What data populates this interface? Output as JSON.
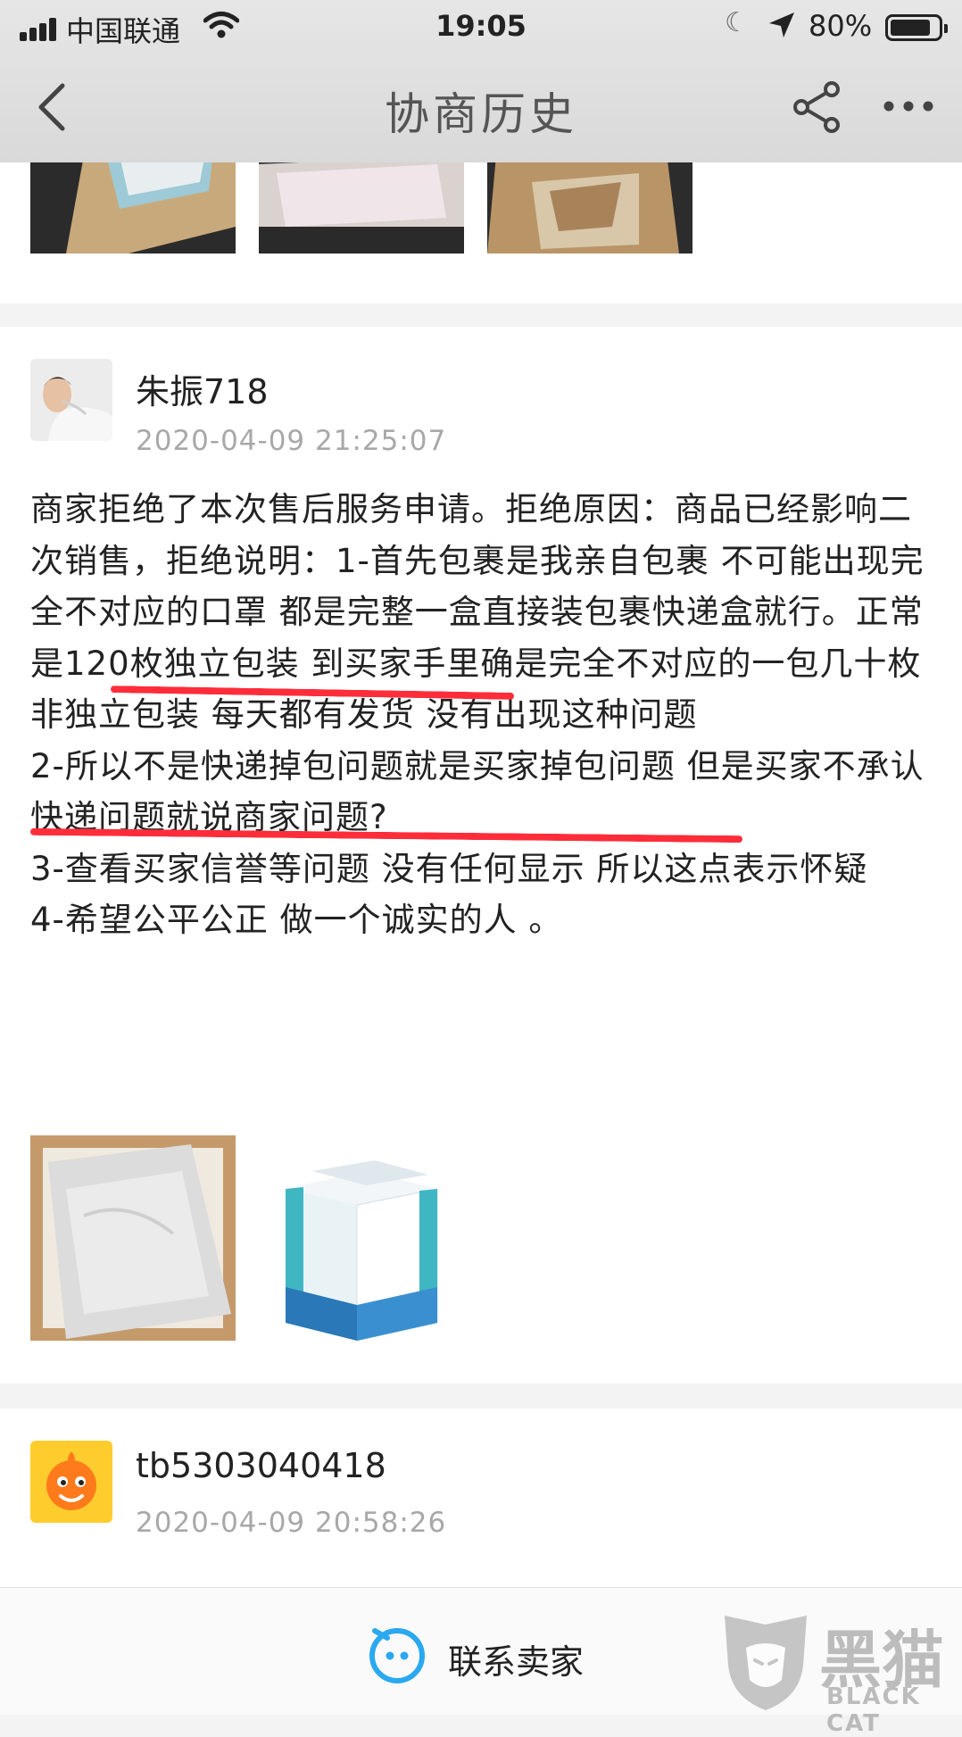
{
  "status_bar": {
    "carrier": "中国联通",
    "time": "19:05",
    "battery": "80%"
  },
  "nav": {
    "title": "协商历史"
  },
  "records": [
    {
      "author": "朱振718",
      "timestamp": "2020-04-09 21:25:07",
      "paragraphs": [
        "商家拒绝了本次售后服务申请。拒绝原因：商品已经影响二次销售，拒绝说明：1-首先包裹是我亲自包裹  不可能出现完全不对应的口罩  都是完整一盒直接装包裹快递盒就行。正常是120枚独立包装 到买家手里确是完全不对应的一包几十枚非独立包装  每天都有发货 没有出现这种问题",
        "2-所以不是快递掉包问题就是买家掉包问题    但是买家不承认快递问题就说商家问题?",
        "3-查看买家信誉等问题  没有任何显示  所以这点表示怀疑",
        "4-希望公平公正  做一个诚实的人  。"
      ]
    },
    {
      "author": "tb5303040418",
      "timestamp": "2020-04-09 20:58:26"
    }
  ],
  "bottom_bar": {
    "contact_label": "联系卖家"
  },
  "watermark": {
    "brand": "黑猫",
    "sub": "BLACK CAT"
  },
  "icons": {
    "back": "chevron-left-icon",
    "share": "share-icon",
    "more": "more-icon",
    "contact": "chat-bot-icon"
  },
  "colors": {
    "highlight_underline": "#ff2d3a",
    "contact_icon": "#2aa8f0"
  }
}
